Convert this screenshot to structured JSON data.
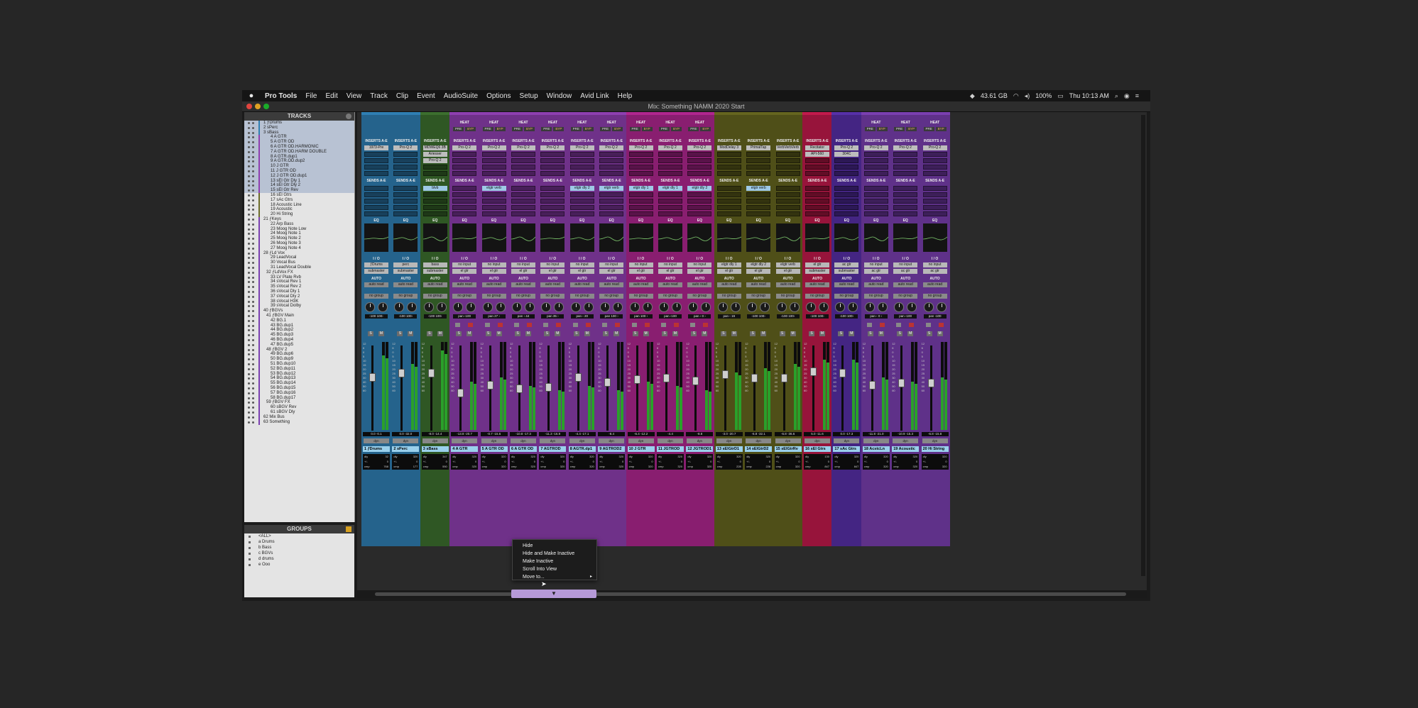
{
  "menubar": {
    "apple": "",
    "app_name": "Pro Tools",
    "items": [
      "File",
      "Edit",
      "View",
      "Track",
      "Clip",
      "Event",
      "AudioSuite",
      "Options",
      "Setup",
      "Window",
      "Avid Link",
      "Help"
    ],
    "status": {
      "disk": "43.61 GB",
      "battery": "100%",
      "clock": "Thu 10:13 AM"
    }
  },
  "window": {
    "title": "Mix: Something NAMM 2020 Start"
  },
  "tracks_panel": {
    "header": "TRACKS",
    "tracks": [
      "1 ƒDrums",
      "2 sPerc",
      "3 sBass",
      "4 A GTR",
      "5 A GTR OD",
      "6 A GTR OD.HARMONIC",
      "7 A GTR OD.HARM DOUBLE",
      "8 A GTR.dup1",
      "9 A GTR.OD.dup2",
      "10 J GTR",
      "11 J GTR OD",
      "12 J GTR OD.dup1",
      "13 sEl Gtr Dly 1",
      "14 sEl Gtr Dly 2",
      "15 sEl Gtr Rev",
      "16 sEl Gtrs",
      "17 sAc Gtrs",
      "18 Acoustic Line",
      "19 Acoustic",
      "20 Hi String",
      "21 ƒKeys",
      "22 Arp Bass",
      "23 Moog Note Low",
      "24 Moog Note 1",
      "25 Moog Note 2",
      "26 Moog Note 3",
      "27 Moog Note 4",
      "28 ƒLd Vox",
      "29 LeadVocal",
      "30 Vocal Bus",
      "31 LeadVocal Double",
      "32 ƒLdVox FX",
      "33 LV Plate Rvb",
      "34 sVocal Rev 1",
      "35 sVocal Rev 2",
      "36 sVocal Dly 1",
      "37 sVocal Dly 2",
      "38 sVocal H3K",
      "39 sVocal Dolby",
      "40 ƒBGVs",
      "41 ƒBGV Main",
      "42 BG.1",
      "43 BG.dup1",
      "44 BG.dup2",
      "45 BG.dup3",
      "46 BG.dup4",
      "47 BG.dup5",
      "48 ƒBGV 2",
      "49 BG.dup6",
      "50 BG.dup9",
      "51 BG.dup10",
      "52 BG.dup11",
      "53 BG.dup12",
      "54 BG.dup13",
      "55 BG.dup14",
      "56 BG.dup15",
      "57 BG.dup16",
      "58 BG.dup17",
      "59 ƒBGV FX",
      "60 sBGV Rev",
      "61 sBGV Dly",
      "62 Mix Bus",
      "63 Something"
    ]
  },
  "groups_panel": {
    "header": "GROUPS",
    "groups": [
      "<ALL>",
      "a  Drums",
      "b  Bass",
      "c  BGVs",
      "d  drums",
      "e  Ooo"
    ]
  },
  "mixer": {
    "labels": {
      "inserts": "INSERTS A-E",
      "sends": "SENDS A-E",
      "eq": "EQ",
      "io": "I / O",
      "auto": "AUTO",
      "heat": "HEAT",
      "pre": "PRE",
      "byp": "BYP",
      "auto_mode": "auto read",
      "group": "no group",
      "solo": "S",
      "mute": "M"
    },
    "strips": [
      {
        "name": "1  ƒDrums",
        "color": "#2f7fb3",
        "heat": false,
        "inserts": [
          "1973-Pre"
        ],
        "sends": [],
        "input": "ƒDrums",
        "output": "submaster",
        "pan": "‹100  100›",
        "vol": "0.0   -0.1",
        "comments": [
          "dly",
          "+/-",
          "cmp"
        ],
        "cvals": [
          "32",
          "0",
          "768"
        ],
        "meter": 0.85,
        "fader": 0.35
      },
      {
        "name": "2  sPerc",
        "color": "#2f7fb3",
        "heat": false,
        "inserts": [
          "Pro-Q 2"
        ],
        "sends": [],
        "input": "perc",
        "output": "submaster",
        "pan": "‹100  100›",
        "vol": "0.0  -32.0",
        "comments": [
          "dly",
          "+/-",
          "cmp"
        ],
        "cvals": [
          "320",
          "0",
          "177"
        ],
        "meter": 0.75,
        "fader": 0.3
      },
      {
        "name": "3  sBass",
        "color": "#3c6f2e",
        "heat": false,
        "inserts": [
          "MDWEQ6 3B",
          "Ariesser",
          "Pro-Q 2"
        ],
        "sends": [
          "blvb"
        ],
        "input": "bass",
        "output": "submaster",
        "pan": "‹100  100›",
        "vol": "-8.0  -14.4",
        "comments": [
          "dly",
          "+/-",
          "cmp"
        ],
        "cvals": [
          "347",
          "0",
          "550"
        ],
        "meter": 0.9,
        "fader": 0.3
      },
      {
        "name": "4  A GTR",
        "color": "#8e3fb0",
        "heat": true,
        "inserts": [
          "Pro-Q 2"
        ],
        "sends": [],
        "input": "no input",
        "output": "el gtr",
        "pan": "pan  ‹100",
        "vol": "-13.8  -20.7",
        "comments": [
          "dly",
          "+/-",
          "cmp"
        ],
        "cvals": [
          "320",
          "0",
          "320"
        ],
        "meter": 0.55,
        "fader": 0.55
      },
      {
        "name": "5  A GTR OD",
        "color": "#8e3fb0",
        "heat": true,
        "inserts": [
          "Pro-Q 2"
        ],
        "sends": [
          "elgtr verb"
        ],
        "input": "no input",
        "output": "el gtr",
        "pan": "pan  27 ›",
        "vol": "-0.7  -15.6",
        "comments": [
          "dly",
          "+/-",
          "cmp"
        ],
        "cvals": [
          "320",
          "0",
          "320"
        ],
        "meter": 0.6,
        "fader": 0.45
      },
      {
        "name": "6  A GTR OD",
        "color": "#8e3fb0",
        "heat": true,
        "inserts": [
          "Pro-Q 2"
        ],
        "sends": [],
        "input": "no input",
        "output": "el gtr",
        "pan": "pan  ‹ 44",
        "vol": "-10.8  -17.3",
        "comments": [
          "dly",
          "+/-",
          "cmp"
        ],
        "cvals": [
          "320",
          "0",
          "320"
        ],
        "meter": 0.5,
        "fader": 0.5
      },
      {
        "name": "7  AGTROD",
        "color": "#8e3fb0",
        "heat": true,
        "inserts": [
          "Pro-Q 2"
        ],
        "sends": [],
        "input": "no input",
        "output": "el gtr",
        "pan": "pan  35 ›",
        "vol": "-11.3  -16.9",
        "comments": [
          "dly",
          "+/-",
          "cmp"
        ],
        "cvals": [
          "320",
          "0",
          "320"
        ],
        "meter": 0.45,
        "fader": 0.48
      },
      {
        "name": "8  AGTR.dp1",
        "color": "#8e3fb0",
        "heat": true,
        "inserts": [
          "Pro-Q 2"
        ],
        "sends": [
          "elgtr dly 2"
        ],
        "input": "no input",
        "output": "el gtr",
        "pan": "pan  ‹ 20",
        "vol": "-4.4  -17.1",
        "comments": [
          "dly",
          "+/-",
          "cmp"
        ],
        "cvals": [
          "320",
          "0",
          "320"
        ],
        "meter": 0.5,
        "fader": 0.35
      },
      {
        "name": "9  AGTROD2",
        "color": "#8e3fb0",
        "heat": true,
        "inserts": [
          "Pro-Q 2"
        ],
        "sends": [
          "elgtr verb"
        ],
        "input": "no input",
        "output": "el gtr",
        "pan": "pan  100 ›",
        "vol": "-8.4",
        "comments": [
          "dly",
          "+/-",
          "cmp"
        ],
        "cvals": [
          "320",
          "0",
          "320"
        ],
        "meter": 0.45,
        "fader": 0.42
      },
      {
        "name": "10  J GTR",
        "color": "#b0268f",
        "heat": true,
        "inserts": [
          "Pro-Q 2"
        ],
        "sends": [
          "elgtr dly 1"
        ],
        "input": "no input",
        "output": "el gtr",
        "pan": "pan  100 ›",
        "vol": "-6.4  -12.2",
        "comments": [
          "dly",
          "+/-",
          "cmp"
        ],
        "cvals": [
          "320",
          "0",
          "320"
        ],
        "meter": 0.55,
        "fader": 0.38
      },
      {
        "name": "11  JGTROD",
        "color": "#b0268f",
        "heat": true,
        "inserts": [
          "Pro-Q 2"
        ],
        "sends": [
          "elgtr dly 1"
        ],
        "input": "no input",
        "output": "el gtr",
        "pan": "pan  ‹100",
        "vol": "-4.4",
        "comments": [
          "dly",
          "+/-",
          "cmp"
        ],
        "cvals": [
          "320",
          "0",
          "320"
        ],
        "meter": 0.5,
        "fader": 0.36
      },
      {
        "name": "12  JGTROD1",
        "color": "#b0268f",
        "heat": true,
        "inserts": [
          "Pro-Q 2"
        ],
        "sends": [
          "elgtr dly 2"
        ],
        "input": "no input",
        "output": "el gtr",
        "pan": "pan  ‹ 0 ›",
        "vol": "-8.8",
        "comments": [
          "dly",
          "+/-",
          "cmp"
        ],
        "cvals": [
          "320",
          "0",
          "320"
        ],
        "meter": 0.45,
        "fader": 0.4
      },
      {
        "name": "13  sElGtrD1",
        "color": "#65651f",
        "heat": false,
        "inserts": [
          "ModDelay 3"
        ],
        "sends": [],
        "input": "elgtr dly 1",
        "output": "el gtr",
        "pan": "pan  ‹ 19",
        "vol": "-3.0  -20.7",
        "comments": [
          "dly",
          "+/-",
          "cmp"
        ],
        "cvals": [
          "320",
          "0",
          "228"
        ],
        "meter": 0.65,
        "fader": 0.32
      },
      {
        "name": "14  sElGtrD2",
        "color": "#65651f",
        "heat": false,
        "inserts": [
          "PrimalTap"
        ],
        "sends": [
          "elgtr verb"
        ],
        "input": "elgtr dly 2",
        "output": "el gtr",
        "pan": "‹100  100›",
        "vol": "-6.8  -32.1",
        "comments": [
          "dly",
          "+/-",
          "cmp"
        ],
        "cvals": [
          "320",
          "0",
          "228"
        ],
        "meter": 0.7,
        "fader": 0.36
      },
      {
        "name": "15  sElGtrRv",
        "color": "#65651f",
        "heat": false,
        "inserts": [
          "VerbVerbVerb"
        ],
        "sends": [],
        "input": "elgtr verb",
        "output": "el gtr",
        "pan": "‹100  100›",
        "vol": "-6.8  -36.6",
        "comments": [
          "dly",
          "+/-",
          "cmp"
        ],
        "cvals": [
          "320",
          "0",
          "320"
        ],
        "meter": 0.75,
        "fader": 0.36
      },
      {
        "name": "16  sEl Gtrs",
        "color": "#c21a4c",
        "heat": false,
        "inserts": [
          "Recitator",
          "API-560"
        ],
        "sends": [],
        "input": "el gtr",
        "output": "submaster",
        "pan": "‹100  100›",
        "vol": "5.0  -11.6",
        "comments": [
          "dly",
          "+/-",
          "cmp"
        ],
        "cvals": [
          "130",
          "0",
          "847"
        ],
        "meter": 0.8,
        "fader": 0.28
      },
      {
        "name": "17  sAc Gtrs",
        "color": "#5730a8",
        "heat": false,
        "inserts": [
          "Pro-Q 2",
          "304C"
        ],
        "sends": [],
        "input": "ac gtr",
        "output": "submaster",
        "pan": "‹100  100›",
        "vol": "0.0  -17.3",
        "comments": [
          "dly",
          "+/-",
          "cmp"
        ],
        "cvals": [
          "320",
          "0",
          "847"
        ],
        "meter": 0.8,
        "fader": 0.3
      },
      {
        "name": "18  AcstcLn",
        "color": "#7a3fb0",
        "heat": true,
        "inserts": [
          "Pro-Q 2"
        ],
        "sends": [],
        "input": "no input",
        "output": "ac gtr",
        "pan": "pan  ‹ 0 ›",
        "vol": "-11.8  -21.0",
        "comments": [
          "dly",
          "+/-",
          "cmp"
        ],
        "cvals": [
          "320",
          "0",
          "320"
        ],
        "meter": 0.6,
        "fader": 0.45
      },
      {
        "name": "19  Acoustic",
        "color": "#7a3fb0",
        "heat": true,
        "inserts": [
          "Pro-Q 2"
        ],
        "sends": [],
        "input": "no input",
        "output": "ac gtr",
        "pan": "pan  ‹100",
        "vol": "-10.9  -15.3",
        "comments": [
          "dly",
          "+/-",
          "cmp"
        ],
        "cvals": [
          "320",
          "0",
          "320"
        ],
        "meter": 0.55,
        "fader": 0.43
      },
      {
        "name": "20  Hi String",
        "color": "#7a3fb0",
        "heat": true,
        "inserts": [
          "Pro-Q 2"
        ],
        "sends": [],
        "input": "no input",
        "output": "ac gtr",
        "pan": "pan  ‹100",
        "vol": "-6.8  -15.8",
        "comments": [
          "dly",
          "+/-",
          "cmp"
        ],
        "cvals": [
          "320",
          "0",
          "320"
        ],
        "meter": 0.6,
        "fader": 0.43
      }
    ]
  },
  "context_menu": {
    "items": [
      {
        "label": "Hide",
        "submenu": false
      },
      {
        "label": "Hide and Make Inactive",
        "submenu": false
      },
      {
        "label": "Make Inactive",
        "submenu": false
      },
      {
        "label": "Scroll Into View",
        "submenu": false
      },
      {
        "label": "Move to...",
        "submenu": true
      }
    ],
    "trigger_icon": "▼"
  }
}
